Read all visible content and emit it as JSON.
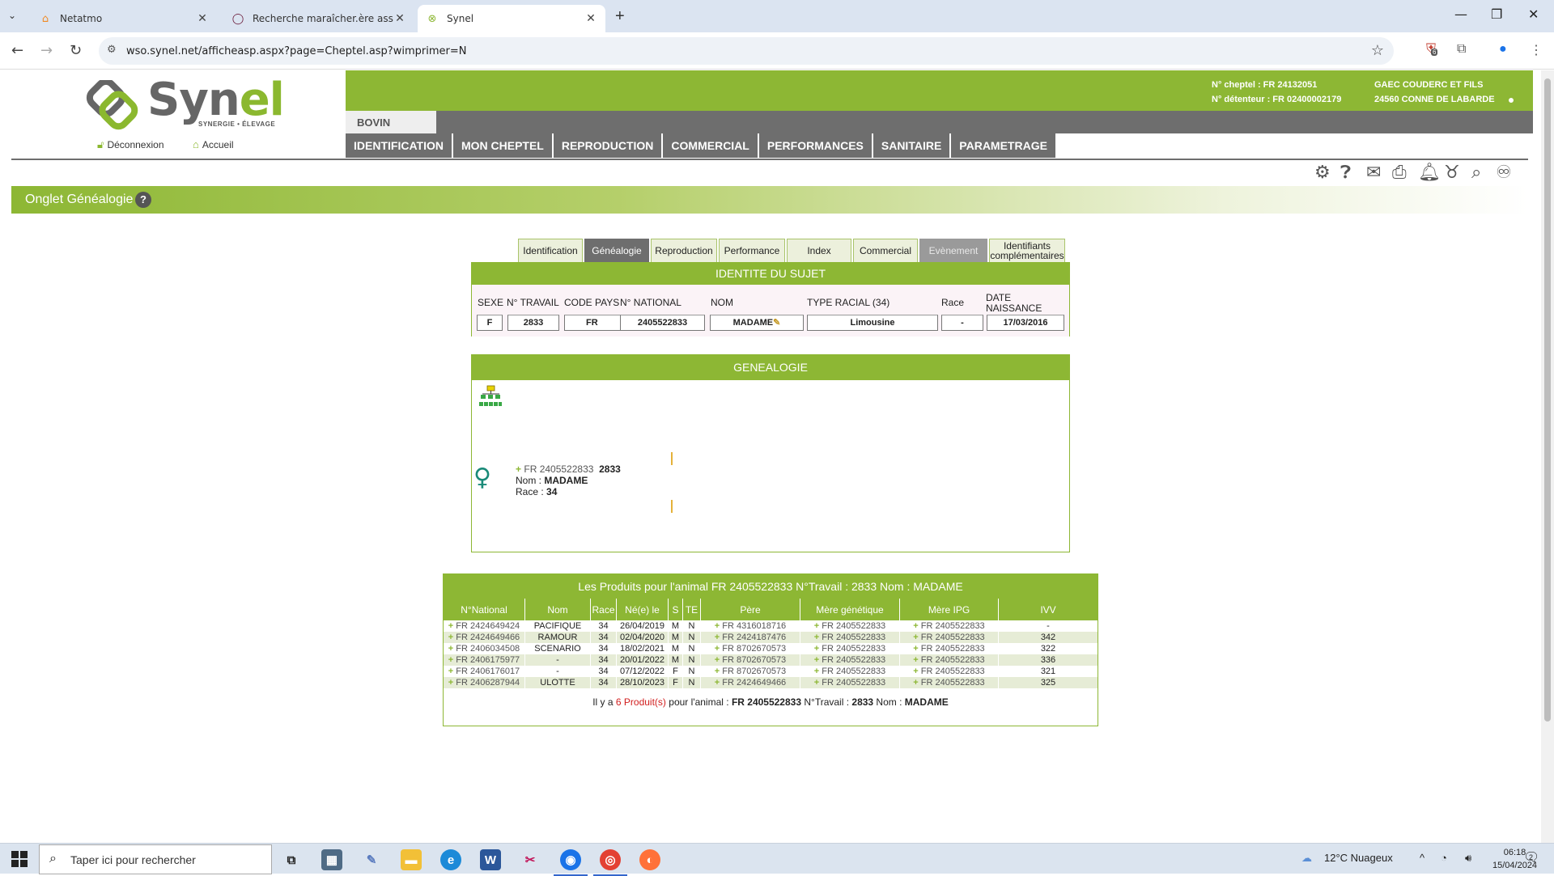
{
  "browser": {
    "tabs": [
      {
        "label": "Netatmo",
        "icon": "house-icon"
      },
      {
        "label": "Recherche maraîcher.ère associ",
        "icon": "circle-icon"
      },
      {
        "label": "Synel",
        "icon": "synel-icon"
      }
    ],
    "url": "wso.synel.net/afficheasp.aspx?page=Cheptel.asp?wimprimer=N",
    "extension_badge": "6"
  },
  "header": {
    "logo_text_main": "Syn",
    "logo_text_accent": "el",
    "logo_tagline": "SYNERGIE • ÉLEVAGE",
    "logout": "Déconnexion",
    "home": "Accueil",
    "cheptel": "N° cheptel : FR 24132051",
    "detenteur": "N° détenteur : FR 02400002179",
    "owner": "GAEC COUDERC ET FILS",
    "address": "24560 CONNE DE LABARDE",
    "species": "BOVIN",
    "menu": [
      "IDENTIFICATION",
      "MON CHEPTEL",
      "REPRODUCTION",
      "COMMERCIAL",
      "PERFORMANCES",
      "SANITAIRE",
      "PARAMETRAGE"
    ]
  },
  "section": {
    "title": "Onglet Généalogie",
    "help": "?"
  },
  "subtabs": [
    "Identification",
    "Généalogie",
    "Reproduction",
    "Performance",
    "Index",
    "Commercial",
    "Evènement",
    "Identifiants complémentaires"
  ],
  "subject": {
    "heading": "IDENTITE DU SUJET",
    "headers": {
      "sexe": "SEXE",
      "travail": "N° TRAVAIL",
      "pays": "CODE PAYS",
      "national": "N° NATIONAL",
      "nom": "NOM",
      "type": "TYPE RACIAL (34)",
      "race": "Race",
      "date": "DATE NAISSANCE"
    },
    "values": {
      "sexe": "F",
      "travail": "2833",
      "pays": "FR",
      "national": "2405522833",
      "nom": "MADAME",
      "type": "Limousine",
      "race": "-",
      "date": "17/03/2016"
    }
  },
  "genealogie": {
    "heading": "GENEALOGIE",
    "animal_id": "FR 2405522833",
    "animal_work": "2833",
    "nom_label": "Nom : ",
    "nom": "MADAME",
    "race_label": "Race : ",
    "race": "34"
  },
  "products": {
    "title": "Les Produits pour l'animal  FR 2405522833  N°Travail : 2833  Nom : MADAME",
    "columns": [
      "N°National",
      "Nom",
      "Race",
      "Né(e) le",
      "S",
      "TE",
      "Père",
      "Mère génétique",
      "Mère IPG",
      "IVV"
    ],
    "rows": [
      {
        "national": "FR 2424649424",
        "nom": "PACIFIQUE",
        "race": "34",
        "ne": "26/04/2019",
        "s": "M",
        "te": "N",
        "pere": "FR 4316018716",
        "mere_gen": "FR 2405522833",
        "mere_ipg": "FR 2405522833",
        "ivv": "-"
      },
      {
        "national": "FR 2424649466",
        "nom": "RAMOUR",
        "race": "34",
        "ne": "02/04/2020",
        "s": "M",
        "te": "N",
        "pere": "FR 2424187476",
        "mere_gen": "FR 2405522833",
        "mere_ipg": "FR 2405522833",
        "ivv": "342"
      },
      {
        "national": "FR 2406034508",
        "nom": "SCENARIO",
        "race": "34",
        "ne": "18/02/2021",
        "s": "M",
        "te": "N",
        "pere": "FR 8702670573",
        "mere_gen": "FR 2405522833",
        "mere_ipg": "FR 2405522833",
        "ivv": "322"
      },
      {
        "national": "FR 2406175977",
        "nom": "-",
        "race": "34",
        "ne": "20/01/2022",
        "s": "M",
        "te": "N",
        "pere": "FR 8702670573",
        "mere_gen": "FR 2405522833",
        "mere_ipg": "FR 2405522833",
        "ivv": "336"
      },
      {
        "national": "FR 2406176017",
        "nom": "-",
        "race": "34",
        "ne": "07/12/2022",
        "s": "F",
        "te": "N",
        "pere": "FR 8702670573",
        "mere_gen": "FR 2405522833",
        "mere_ipg": "FR 2405522833",
        "ivv": "321"
      },
      {
        "national": "FR 2406287944",
        "nom": "ULOTTE",
        "race": "34",
        "ne": "28/10/2023",
        "s": "F",
        "te": "N",
        "pere": "FR 2424649466",
        "mere_gen": "FR 2405522833",
        "mere_ipg": "FR 2405522833",
        "ivv": "325"
      }
    ],
    "summary": {
      "prefix": "Il y a ",
      "count": "6 Produit(s)",
      "middle": " pour l'animal : ",
      "animal": "FR 2405522833",
      "work_label": " N°Travail : ",
      "work": "2833",
      "nom_label": " Nom : ",
      "nom": "MADAME"
    }
  },
  "taskbar": {
    "search_placeholder": "Taper ici pour rechercher",
    "weather": "12°C  Nuageux",
    "time": "06:18",
    "date": "15/04/2024",
    "notifications": "2"
  },
  "colors": {
    "accent": "#8db734",
    "grey": "#6e6e6e",
    "alert": "#d21e1e"
  }
}
